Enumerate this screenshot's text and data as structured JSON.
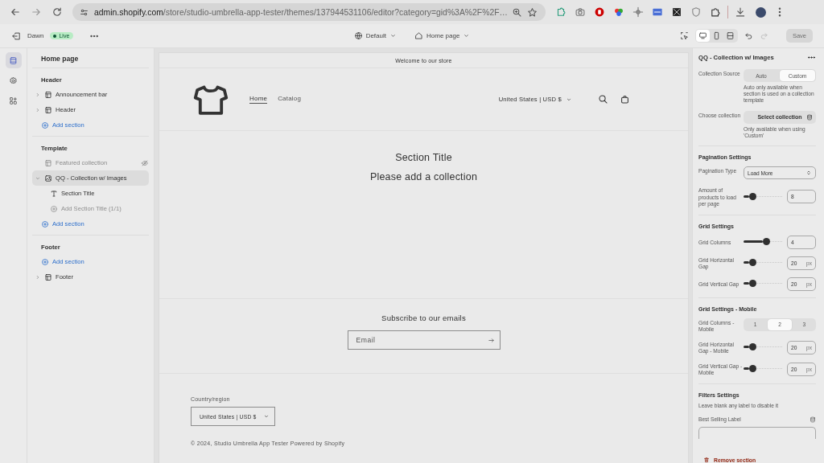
{
  "browser": {
    "url_host": "admin.shopify.com",
    "url_path": "/store/studio-umbrella-app-tester/themes/137944531106/editor?category=gid%3A%2F%2F…"
  },
  "editor_bar": {
    "theme": "Dawn",
    "status": "Live",
    "template": "Default",
    "page": "Home page",
    "save": "Save",
    "save_disabled": true,
    "view_modes": [
      {
        "kind": "desktop",
        "selected": true
      },
      {
        "kind": "mobile",
        "selected": false
      },
      {
        "kind": "fullscreen",
        "selected": false
      }
    ]
  },
  "rail": [
    {
      "kind": "sections",
      "selected": true
    },
    {
      "kind": "settings",
      "selected": false
    },
    {
      "kind": "apps",
      "selected": false
    }
  ],
  "sidebar": {
    "title": "Home page",
    "groups": [
      {
        "title": "Header",
        "items": [
          {
            "kind": "section",
            "label": "Announcement bar",
            "expanded": false,
            "selected": false,
            "hidden": false
          },
          {
            "kind": "section",
            "label": "Header",
            "expanded": false,
            "selected": false,
            "hidden": false
          },
          {
            "kind": "add",
            "label": "Add section"
          }
        ]
      },
      {
        "title": "Template",
        "items": [
          {
            "kind": "section",
            "label": "Featured collection",
            "selected": false,
            "hidden": true
          },
          {
            "kind": "section",
            "label": "QQ - Collection w/ Images",
            "expanded": true,
            "selected": true,
            "hidden": false,
            "children": [
              {
                "kind": "block",
                "label": "Section Title",
                "disabled": false
              },
              {
                "kind": "add-block",
                "label": "Add Section Title (1/1)",
                "disabled": true
              }
            ]
          },
          {
            "kind": "add",
            "label": "Add section"
          }
        ]
      },
      {
        "title": "Footer",
        "items": [
          {
            "kind": "add",
            "label": "Add section"
          },
          {
            "kind": "section",
            "label": "Footer",
            "expanded": false,
            "selected": false,
            "hidden": false
          }
        ]
      }
    ]
  },
  "preview": {
    "announcement": "Welcome to our store",
    "nav": [
      {
        "label": "Home",
        "selected": true
      },
      {
        "label": "Catalog",
        "selected": false
      }
    ],
    "currency": "United States | USD $",
    "section_title": "Section Title",
    "message": "Please add a collection",
    "newsletter": {
      "title": "Subscribe to our emails",
      "placeholder": "Email"
    },
    "footer": {
      "country_label": "Country/region",
      "country": "United States | USD $",
      "copyright": "© 2024, Studio Umbrella App Tester Powered by Shopify"
    }
  },
  "settings": {
    "title": "QQ - Collection w/ Images",
    "rows": [
      {
        "kind": "segmented",
        "label": "Collection Source",
        "options": [
          {
            "label": "Auto",
            "selected": false
          },
          {
            "label": "Custom",
            "selected": true
          }
        ],
        "help": "Auto only available when section is used on a collection template"
      },
      {
        "kind": "button",
        "label": "Choose collection",
        "button": "Select collection",
        "help": "Only available when using 'Custom'"
      },
      {
        "kind": "heading",
        "label": "Pagination Settings"
      },
      {
        "kind": "select",
        "label": "Pagination Type",
        "value": "Load More"
      },
      {
        "kind": "range",
        "label": "Amount of products to load per page",
        "level": 0.15,
        "value": "8"
      },
      {
        "kind": "heading",
        "label": "Grid Settings"
      },
      {
        "kind": "range",
        "label": "Grid Columns",
        "level": 0.5,
        "value": "4"
      },
      {
        "kind": "range",
        "label": "Grid Horizontal Gap",
        "level": 0.15,
        "value": "20",
        "unit": "px"
      },
      {
        "kind": "range",
        "label": "Grid Vertical Gap",
        "level": 0.15,
        "value": "20",
        "unit": "px"
      },
      {
        "kind": "heading",
        "label": "Grid Settings - Mobile"
      },
      {
        "kind": "segmented",
        "label": "Grid Columns - Mobile",
        "options": [
          {
            "label": "1",
            "selected": false
          },
          {
            "label": "2",
            "selected": true
          },
          {
            "label": "3",
            "selected": false
          }
        ]
      },
      {
        "kind": "range",
        "label": "Grid Horizontal Gap - Mobile",
        "level": 0.15,
        "value": "20",
        "unit": "px"
      },
      {
        "kind": "range",
        "label": "Grid Vertical Gap - Mobile",
        "level": 0.15,
        "value": "20",
        "unit": "px"
      },
      {
        "kind": "heading",
        "label": "Filters Settings"
      },
      {
        "kind": "note",
        "label": "Leave blank any label to disable it"
      },
      {
        "kind": "text",
        "label": "Best Selling Label"
      }
    ],
    "remove": "Remove section"
  }
}
